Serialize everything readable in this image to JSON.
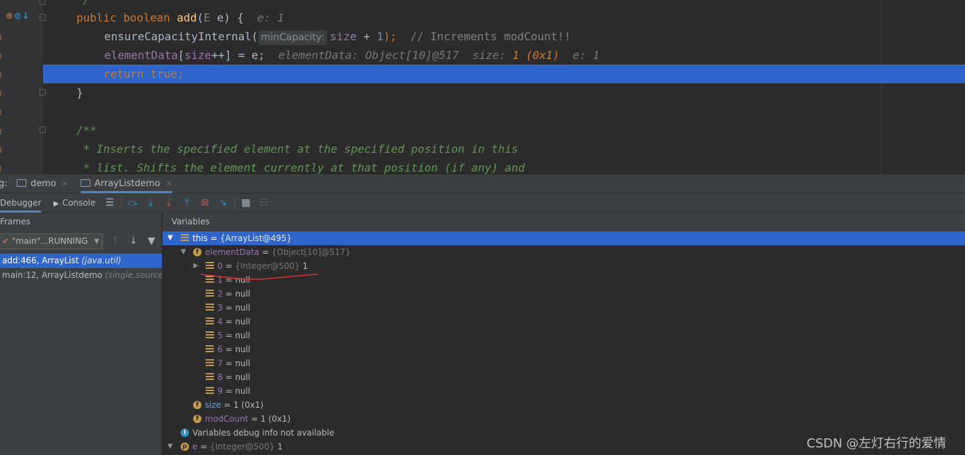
{
  "editor": {
    "line_top_comment": "*/",
    "line_method": {
      "kw1": "public",
      "kw2": "boolean",
      "name": "add",
      "open": "(",
      "type": "E",
      "param": " e) {",
      "ghost": "e: 1"
    },
    "line_ensure": {
      "call": "ensureCapacityInternal(",
      "hint": "minCapacity:",
      "arg_a": "size",
      "arg_b": " + ",
      "arg_c": "1",
      "close": ");",
      "comment": "// Increments modCount!!"
    },
    "line_assign": {
      "field": "elementData",
      "br_open": "[",
      "size": "size",
      "rest": "++] = e;",
      "ghost1": "elementData: Object[10]@517",
      "ghost2": "size:",
      "ghost2_val": "1 (0x1)",
      "ghost3": "e: 1"
    },
    "line_return": {
      "kw": "return",
      "val": "true",
      "semi": ";"
    },
    "line_brace": "}",
    "line_doc_open": "/**",
    "line_doc1": " * Inserts the specified element at the specified position in this",
    "line_doc2": " * list. Shifts the element currently at that position (if any) and"
  },
  "tabbar": {
    "prefix": "g:",
    "tabs": [
      {
        "label": "demo",
        "active": false
      },
      {
        "label": "ArrayListdemo",
        "active": true
      }
    ],
    "close_glyph": "✕"
  },
  "toolbar": {
    "debugger_label": "Debugger",
    "console_label": "Console"
  },
  "frames": {
    "title": "Frames",
    "thread": "\"main\"...RUNNING",
    "rows": [
      {
        "method": "add:466, ArrayList",
        "pkg": "(java.util)",
        "selected": true
      },
      {
        "method": "main:12, ArrayListdemo",
        "pkg": "(single.sourceC",
        "selected": false
      }
    ]
  },
  "variables": {
    "title": "Variables",
    "this_row": {
      "name": "this",
      "eq": " = ",
      "value": "{ArrayList@495}"
    },
    "elementData_row": {
      "name": "elementData",
      "eq": " = ",
      "value": "{Object[10]@517}"
    },
    "item0": {
      "name": "0",
      "eq": " = ",
      "type": "{Integer@500}",
      "value": " 1"
    },
    "null_items": [
      {
        "name": "1",
        "value": " = null"
      },
      {
        "name": "2",
        "value": " = null"
      },
      {
        "name": "3",
        "value": " = null"
      },
      {
        "name": "4",
        "value": " = null"
      },
      {
        "name": "5",
        "value": " = null"
      },
      {
        "name": "6",
        "value": " = null"
      },
      {
        "name": "7",
        "value": " = null"
      },
      {
        "name": "8",
        "value": " = null"
      },
      {
        "name": "9",
        "value": " = null"
      }
    ],
    "size_row": {
      "name": "size",
      "value": " = 1 (0x1)"
    },
    "modcount_row": {
      "name": "modCount",
      "value": " = 1 (0x1)"
    },
    "info_row": "Variables debug info not available",
    "e_row": {
      "name": "e",
      "eq": " = ",
      "type": "{Integer@500}",
      "value": " 1"
    }
  },
  "watermark": "CSDN @左灯右行的爱情",
  "colors": {
    "selection": "#2f65ca",
    "editor_bg": "#2b2b2b",
    "keyword": "#cc7832",
    "annotation_red": "#e03030"
  }
}
